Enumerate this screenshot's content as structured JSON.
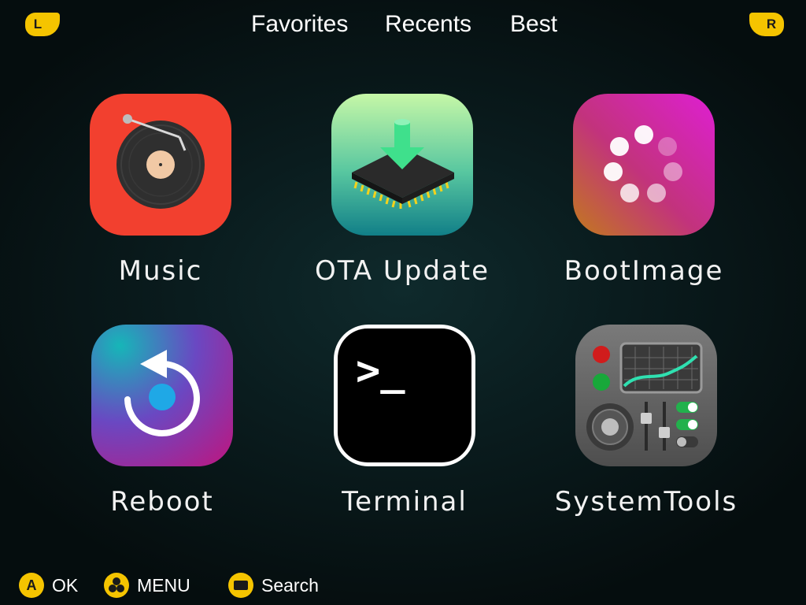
{
  "shoulders": {
    "left": "L",
    "right": "R"
  },
  "tabs": [
    {
      "label": "Favorites"
    },
    {
      "label": "Recents"
    },
    {
      "label": "Best"
    }
  ],
  "apps": [
    {
      "label": "Music",
      "icon": "record-player-icon"
    },
    {
      "label": "OTA Update",
      "icon": "chip-download-icon"
    },
    {
      "label": "BootImage",
      "icon": "loading-spinner-icon"
    },
    {
      "label": "Reboot",
      "icon": "reboot-arrow-icon"
    },
    {
      "label": "Terminal",
      "icon": "terminal-prompt-icon"
    },
    {
      "label": "SystemTools",
      "icon": "control-panel-icon"
    }
  ],
  "terminal_prompt": ">_",
  "hints": [
    {
      "button": "A",
      "label": "OK"
    },
    {
      "button": "",
      "label": "MENU",
      "icon": "menu-dots-icon"
    },
    {
      "button": "",
      "label": "Search",
      "icon": "select-button-icon"
    }
  ],
  "colors": {
    "accent": "#f5c400",
    "music": "#f0402e",
    "background": "#0a1c1e"
  }
}
